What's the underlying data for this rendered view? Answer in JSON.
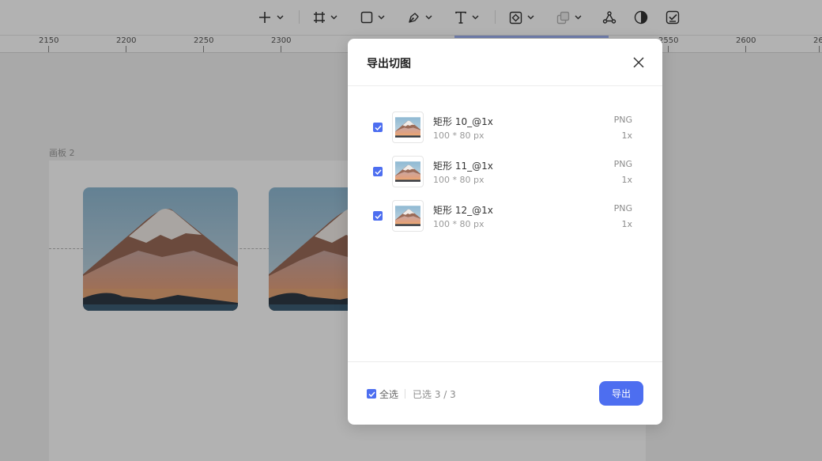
{
  "ruler": {
    "labels": [
      "2150",
      "2200",
      "2250",
      "2300",
      "2550",
      "2600",
      "26"
    ]
  },
  "canvas": {
    "board_label": "画板 2"
  },
  "toolbar": {
    "icons": [
      "plus-icon",
      "frame-icon",
      "rectangle-icon",
      "pen-icon",
      "text-icon",
      "component-icon",
      "boolean-icon",
      "vector-network-icon",
      "contrast-icon",
      "check-board-icon"
    ]
  },
  "dialog": {
    "title": "导出切图",
    "items": [
      {
        "name": "矩形 10_@1x",
        "size": "100 * 80 px",
        "format": "PNG",
        "scale": "1x",
        "checked": true
      },
      {
        "name": "矩形 11_@1x",
        "size": "100 * 80 px",
        "format": "PNG",
        "scale": "1x",
        "checked": true
      },
      {
        "name": "矩形 12_@1x",
        "size": "100 * 80 px",
        "format": "PNG",
        "scale": "1x",
        "checked": true
      }
    ],
    "footer": {
      "select_all_label": "全选",
      "selected_count": "已选 3 / 3",
      "export_label": "导出"
    }
  },
  "colors": {
    "accent": "#4d6ef0"
  }
}
